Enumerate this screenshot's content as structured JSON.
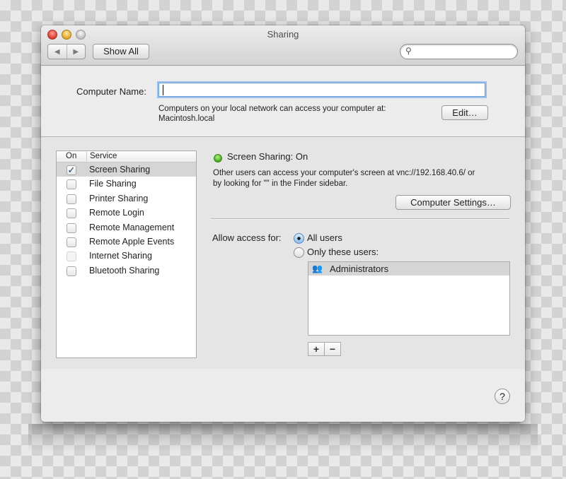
{
  "window": {
    "title": "Sharing",
    "toolbar": {
      "back_icon": "◀",
      "forward_icon": "▶",
      "show_all_label": "Show All",
      "search_icon": "⚲",
      "search_value": "",
      "search_placeholder": ""
    }
  },
  "computer_name": {
    "label": "Computer Name:",
    "value": "",
    "help_line1": "Computers on your local network can access your computer at:",
    "help_line2": "Macintosh.local",
    "edit_label": "Edit…"
  },
  "services": {
    "header_on": "On",
    "header_service": "Service",
    "items": [
      {
        "name": "Screen Sharing",
        "checked": true,
        "enabled": true,
        "selected": true
      },
      {
        "name": "File Sharing",
        "checked": false,
        "enabled": true,
        "selected": false
      },
      {
        "name": "Printer Sharing",
        "checked": false,
        "enabled": true,
        "selected": false
      },
      {
        "name": "Remote Login",
        "checked": false,
        "enabled": true,
        "selected": false
      },
      {
        "name": "Remote Management",
        "checked": false,
        "enabled": true,
        "selected": false
      },
      {
        "name": "Remote Apple Events",
        "checked": false,
        "enabled": true,
        "selected": false
      },
      {
        "name": "Internet Sharing",
        "checked": false,
        "enabled": false,
        "selected": false
      },
      {
        "name": "Bluetooth Sharing",
        "checked": false,
        "enabled": true,
        "selected": false
      }
    ]
  },
  "detail": {
    "status_label": "Screen Sharing: On",
    "status_color": "#3fa51b",
    "description_line1": "Other users can access your computer's screen at vnc://192.168.40.6/ or",
    "description_line2": "by looking for \"\" in the Finder sidebar.",
    "computer_settings_label": "Computer Settings…",
    "access_label": "Allow access for:",
    "radio_all_users": "All users",
    "radio_only_these": "Only these users:",
    "selected_access": "All users",
    "users": [
      {
        "name": "Administrators",
        "icon": "group-icon"
      }
    ],
    "add_label": "+",
    "remove_label": "−"
  },
  "help_label": "?"
}
